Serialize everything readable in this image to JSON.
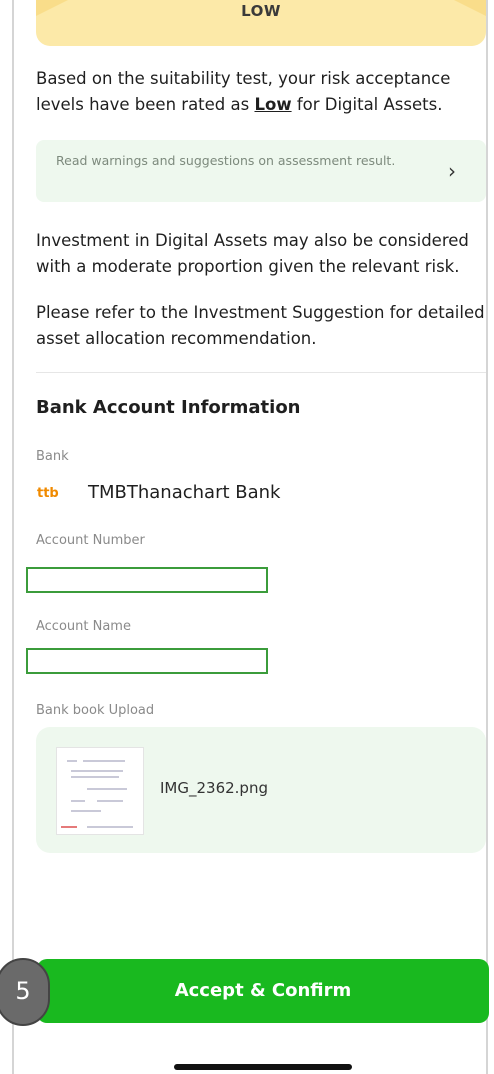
{
  "risk": {
    "level_label": "LOW",
    "summary_prefix": "Based on the suitability test, your risk acceptance levels have been rated as ",
    "summary_level": "Low",
    "summary_suffix": " for Digital Assets."
  },
  "warning": {
    "text": "Read warnings and suggestions on assessment result.",
    "icon": "chevron-right-icon"
  },
  "paragraphs": {
    "investment": "Investment in Digital Assets may also be considered with a moderate proportion given the relevant risk.",
    "refer": "Please refer to the Investment Suggestion for detailed asset allocation recommendation."
  },
  "bank_section": {
    "title": "Bank Account Information",
    "bank_label": "Bank",
    "bank_logo_text": "ttb",
    "bank_name": "TMBThanachart Bank",
    "account_number_label": "Account Number",
    "account_number_value": "",
    "account_name_label": "Account Name",
    "account_name_value": "",
    "upload_label": "Bank book Upload",
    "upload_file_name": "IMG_2362.png"
  },
  "actions": {
    "confirm_label": "Accept & Confirm",
    "step_number": "5"
  },
  "colors": {
    "accent_green": "#19b91f",
    "banner_yellow": "#fce9a8",
    "soft_green": "#eef8ee",
    "highlight_border": "#3b9c3b"
  }
}
